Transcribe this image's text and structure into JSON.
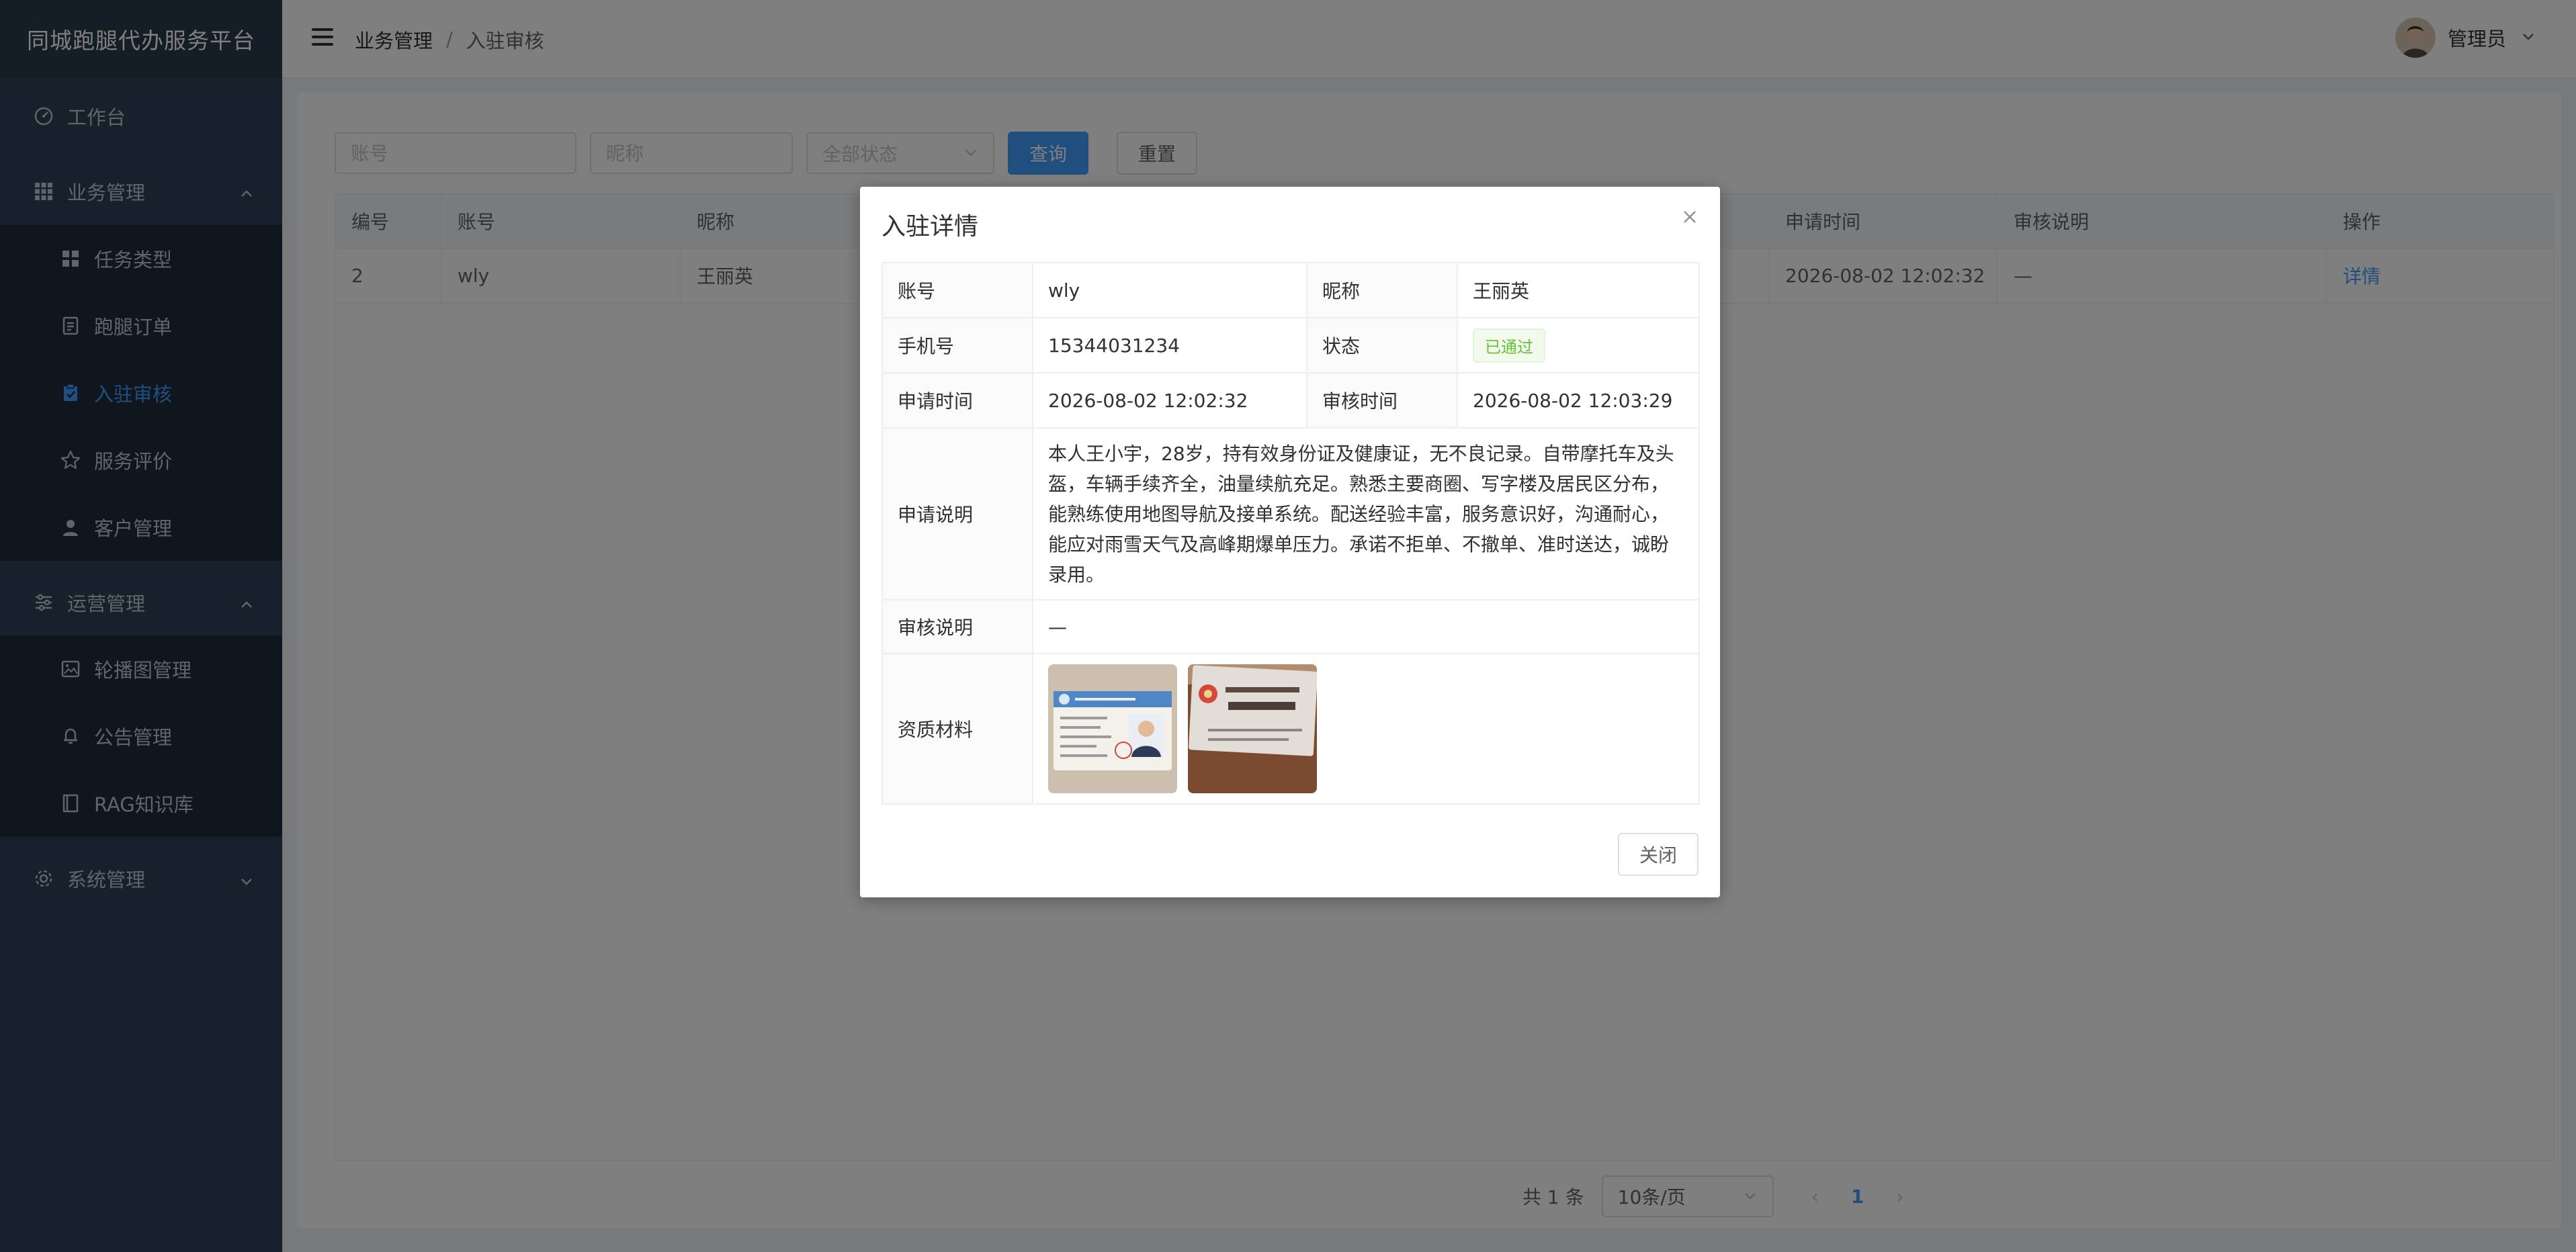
{
  "app": {
    "title": "同城跑腿代办服务平台"
  },
  "sidebar": {
    "items": [
      {
        "label": "工作台"
      },
      {
        "label": "业务管理"
      },
      {
        "label": "任务类型"
      },
      {
        "label": "跑腿订单"
      },
      {
        "label": "入驻审核"
      },
      {
        "label": "服务评价"
      },
      {
        "label": "客户管理"
      },
      {
        "label": "运营管理"
      },
      {
        "label": "轮播图管理"
      },
      {
        "label": "公告管理"
      },
      {
        "label": "RAG知识库"
      },
      {
        "label": "系统管理"
      }
    ]
  },
  "header": {
    "breadcrumb": [
      "业务管理",
      "入驻审核"
    ],
    "breadcrumb_sep": "/",
    "user": "管理员"
  },
  "search": {
    "account_placeholder": "账号",
    "nickname_placeholder": "昵称",
    "status_value": "全部状态",
    "query_label": "查询",
    "reset_label": "重置"
  },
  "table": {
    "columns": [
      "编号",
      "账号",
      "昵称",
      "申请时间",
      "审核说明",
      "操作"
    ],
    "rows": [
      {
        "id": "2",
        "account": "wly",
        "nickname": "王丽英",
        "apply_time": "2026-08-02 12:02:32",
        "review_note": "—",
        "action": "详情"
      }
    ]
  },
  "pagination": {
    "total": "共 1 条",
    "page_size": "10条/页",
    "prev": "‹",
    "current": "1",
    "next": "›"
  },
  "dialog": {
    "title": "入驻详情",
    "labels": {
      "account": "账号",
      "nickname": "昵称",
      "phone": "手机号",
      "status": "状态",
      "apply_time": "申请时间",
      "review_time": "审核时间",
      "apply_desc": "申请说明",
      "review_note": "审核说明",
      "materials": "资质材料"
    },
    "values": {
      "account": "wly",
      "nickname": "王丽英",
      "phone": "15344031234",
      "status": "已通过",
      "apply_time": "2026-08-02 12:02:32",
      "review_time": "2026-08-02 12:03:29",
      "apply_desc": "本人王小宇，28岁，持有效身份证及健康证，无不良记录。自带摩托车及头盔，车辆手续齐全，油量续航充足。熟悉主要商圈、写字楼及居民区分布，能熟练使用地图导航及接单系统。配送经验丰富，服务意识好，沟通耐心，能应对雨雪天气及高峰期爆单压力。承诺不拒单、不撤单、准时送达，诚盼录用。",
      "review_note": "—"
    },
    "close_label": "关闭"
  },
  "colors": {
    "sidebar_bg": "#304156",
    "accent": "#409eff",
    "success": "#67c23a"
  }
}
